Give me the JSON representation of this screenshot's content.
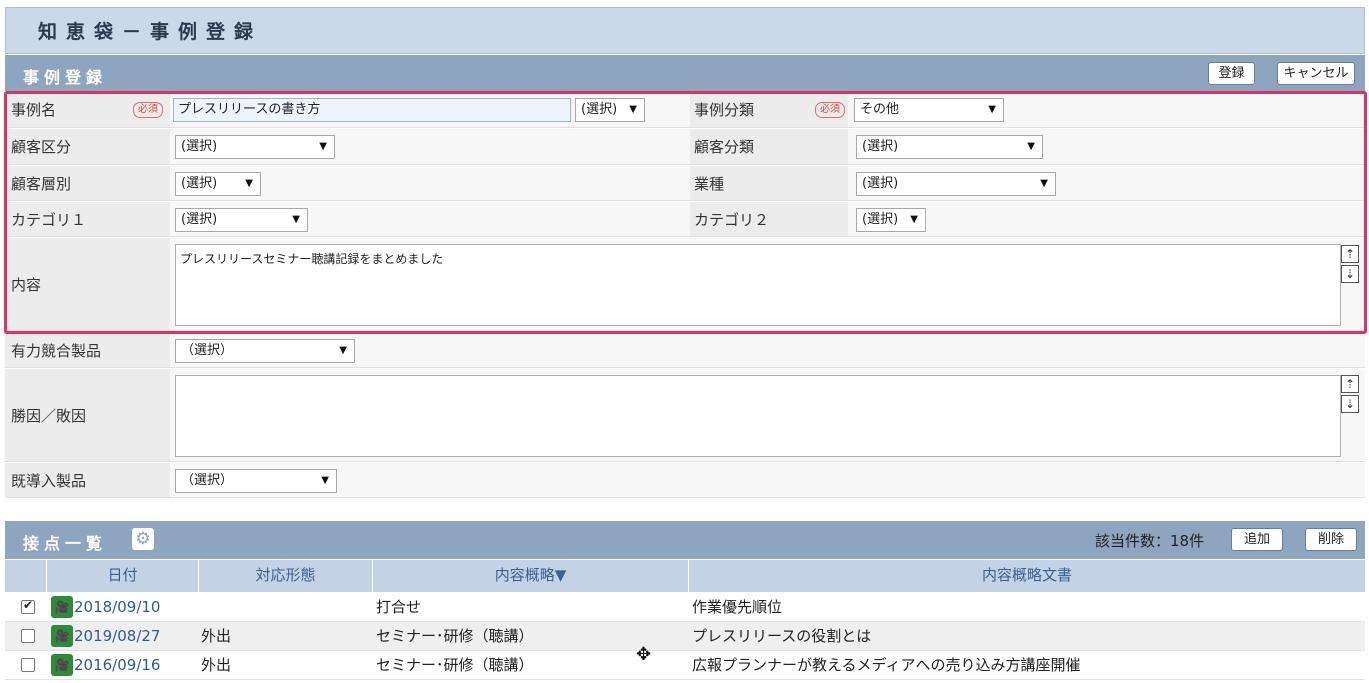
{
  "app": {
    "title": "知恵袋－事例登録"
  },
  "form_section": {
    "title": "事例登録",
    "register_button": "登録",
    "cancel_button": "キャンセル"
  },
  "required_badge": "必須",
  "fields": {
    "case_name": {
      "label": "事例名",
      "value": "プレスリリースの書き方",
      "select": "(選択)"
    },
    "case_class": {
      "label": "事例分類",
      "value": "その他"
    },
    "customer_division": {
      "label": "顧客区分",
      "value": "(選択)"
    },
    "customer_class": {
      "label": "顧客分類",
      "value": "(選択)"
    },
    "customer_tier": {
      "label": "顧客層別",
      "value": "(選択)"
    },
    "industry": {
      "label": "業種",
      "value": "(選択)"
    },
    "category1": {
      "label": "カテゴリ１",
      "value": "(選択)"
    },
    "category2": {
      "label": "カテゴリ２",
      "value": "(選択)"
    },
    "content": {
      "label": "内容",
      "value": "プレスリリースセミナー聴講記録をまとめました"
    },
    "competitor": {
      "label": "有力競合製品",
      "value": "（選択）"
    },
    "win_loss": {
      "label": "勝因／敗因",
      "value": ""
    },
    "installed": {
      "label": "既導入製品",
      "value": "（選択）"
    }
  },
  "contacts_section": {
    "title": "接点一覧",
    "count_text": "該当件数：18件",
    "add_button": "追加",
    "delete_button": "削除",
    "columns": [
      "日付",
      "対応形態",
      "内容概略▼",
      "内容概略文書"
    ],
    "rows": [
      {
        "checked": true,
        "date": "2018/09/10",
        "type": "",
        "summary": "打合せ",
        "doc": "作業優先順位"
      },
      {
        "checked": false,
        "date": "2019/08/27",
        "type": "外出",
        "summary": "セミナー･研修（聴講）",
        "doc": "プレスリリースの役割とは"
      },
      {
        "checked": false,
        "date": "2016/09/16",
        "type": "外出",
        "summary": "セミナー･研修（聴講）",
        "doc": "広報プランナーが教えるメディアへの売り込み方講座開催"
      }
    ]
  },
  "icons": {
    "settings": "gear-icon",
    "record": "film-icon",
    "scroll_up": "arrow-up-icon",
    "scroll_down": "arrow-down-icon"
  }
}
